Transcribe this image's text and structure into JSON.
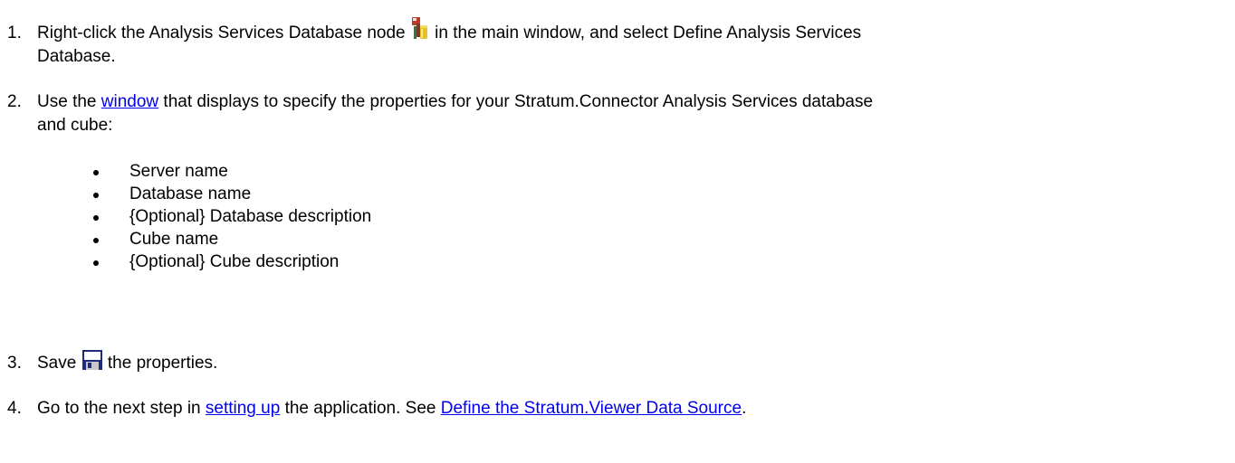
{
  "steps": [
    {
      "number": "1.",
      "text_before": "Right-click the Analysis Services Database node ",
      "icon": "analysis-services-database-node-icon",
      "text_after": " in the main window, and select Define Analysis Services",
      "text_line2": "Database."
    },
    {
      "number": "2.",
      "text_before": "Use the ",
      "link": "window",
      "text_after": " that displays to specify the properties for your Stratum.Connector Analysis Services database",
      "text_line2": "and cube:",
      "bullets": [
        "Server name",
        "Database name",
        "{Optional} Database description",
        "Cube name",
        "{Optional} Cube description"
      ]
    },
    {
      "number": "3.",
      "text_before": "Save ",
      "icon": "save-icon",
      "text_after": " the properties."
    },
    {
      "number": "4.",
      "text_before": "Go to the next step in ",
      "link1": "setting up",
      "text_middle": " the application. See ",
      "link2": "Define the Stratum.Viewer Data Source",
      "text_after": "."
    }
  ],
  "colors": {
    "link": "#0000ee",
    "text": "#000000"
  }
}
